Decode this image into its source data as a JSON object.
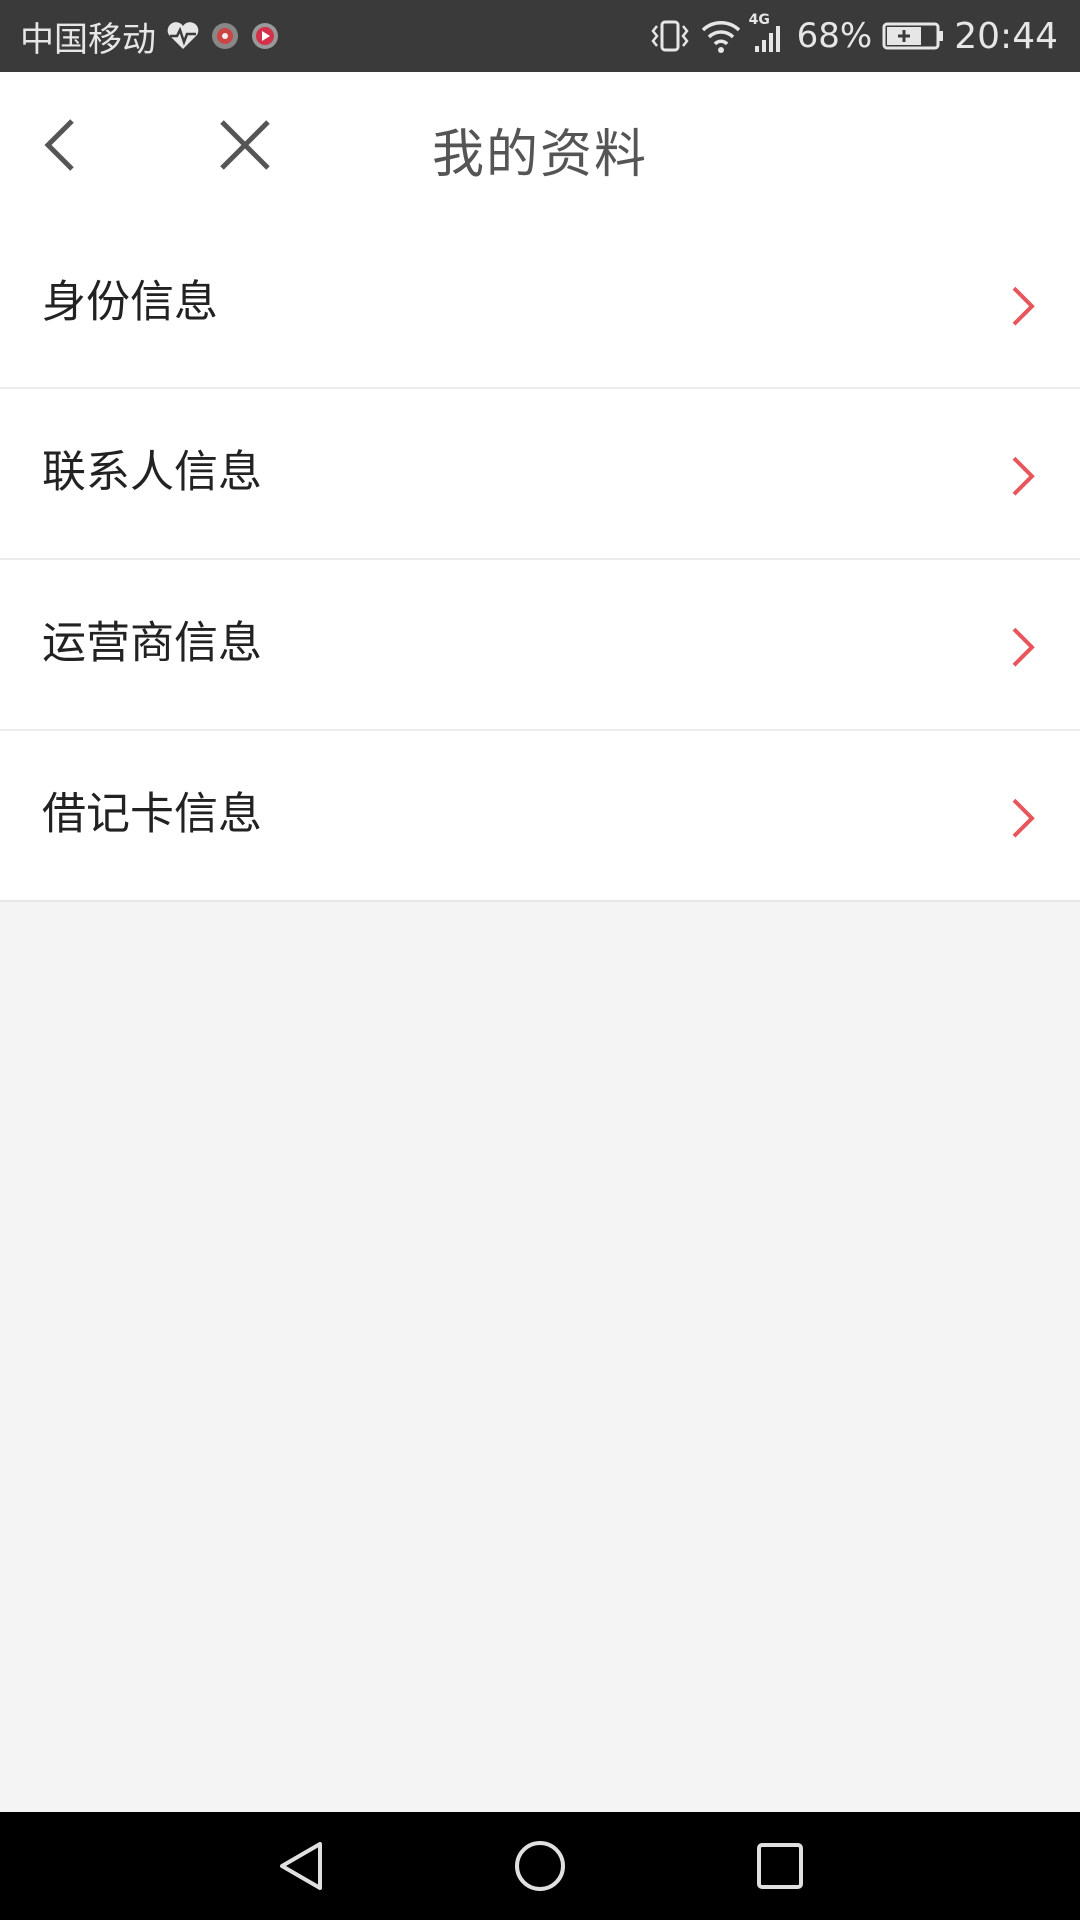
{
  "status_bar": {
    "carrier": "中国移动",
    "network": "4G",
    "battery_percent": "68%",
    "time": "20:44",
    "icons": [
      "heart-rate-icon",
      "app-notification-icon",
      "video-notification-icon",
      "vibrate-icon",
      "wifi-icon",
      "signal-icon",
      "battery-charging-icon"
    ]
  },
  "header": {
    "title": "我的资料",
    "back_icon": "chevron-left-icon",
    "close_icon": "close-icon"
  },
  "menu": {
    "items": [
      {
        "label": "身份信息",
        "icon": "chevron-right-icon"
      },
      {
        "label": "联系人信息",
        "icon": "chevron-right-icon"
      },
      {
        "label": "运营商信息",
        "icon": "chevron-right-icon"
      },
      {
        "label": "借记卡信息",
        "icon": "chevron-right-icon"
      }
    ]
  },
  "system_nav": {
    "buttons": [
      "nav-back-icon",
      "nav-home-icon",
      "nav-recent-icon"
    ]
  },
  "colors": {
    "status_bar_bg": "#3a3a3a",
    "accent_chevron": "#e8555a",
    "background": "#f4f4f4",
    "title_text": "#555555"
  }
}
